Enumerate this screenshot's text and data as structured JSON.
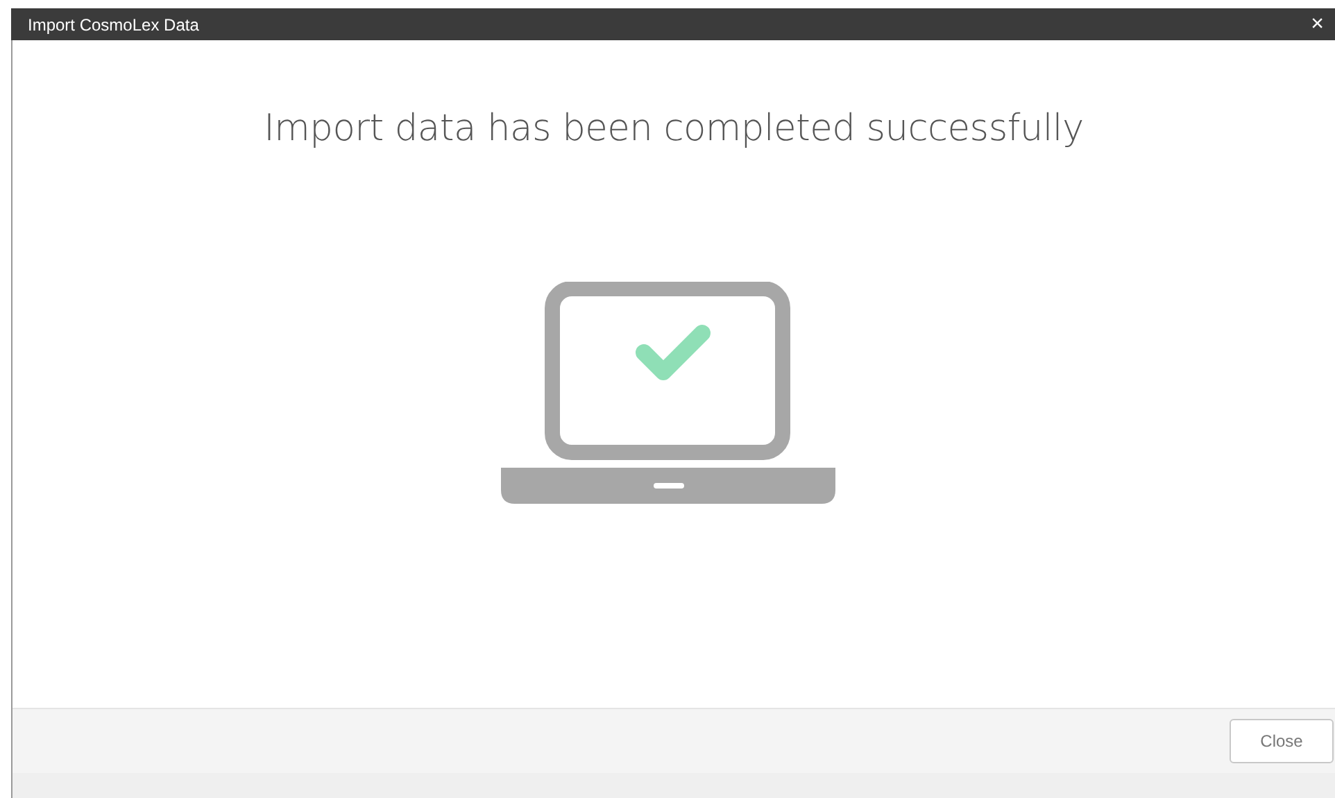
{
  "window": {
    "title": "Import CosmoLex Data",
    "close": "×"
  },
  "message": "Import data has been completed successfully",
  "buttons": [
    "Close"
  ]
}
